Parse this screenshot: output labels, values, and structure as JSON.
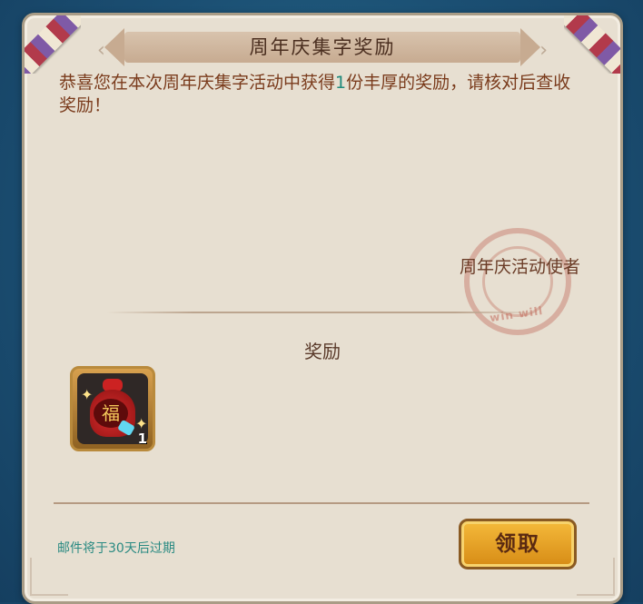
{
  "dialog": {
    "title": "周年庆集字奖励",
    "message_part1": "恭喜您在本次周年庆集字活动中获得",
    "message_count": "1",
    "message_part2": "份丰厚的奖励，请核对后查收奖励！",
    "sender": "周年庆活动使者",
    "reward_section_title": "奖励",
    "reward_item": {
      "icon": "fortune-bag-icon",
      "quantity": "1",
      "glyph": "福"
    },
    "stamp_text": "win will",
    "expiry_notice": "邮件将于30天后过期",
    "claim_button_label": "领取"
  }
}
